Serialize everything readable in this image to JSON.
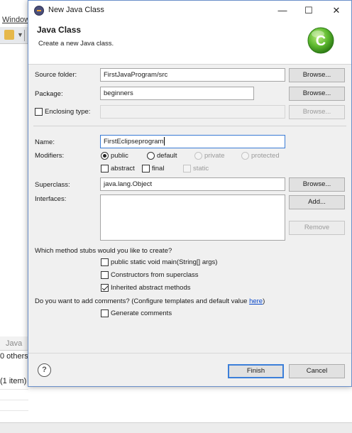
{
  "background": {
    "menu_label": "Window",
    "panel_tab_label": "Java",
    "problems_text": "0 others",
    "items_text": "(1 item)"
  },
  "titlebar": {
    "title": "New Java Class",
    "minimize_glyph": "—",
    "maximize_glyph": "☐",
    "close_glyph": "✕"
  },
  "header": {
    "title": "Java Class",
    "subtitle": "Create a new Java class."
  },
  "form": {
    "source_folder_label": "Source folder:",
    "source_folder_value": "FirstJavaProgram/src",
    "package_label": "Package:",
    "package_value": "beginners",
    "enclosing_type_label": "Enclosing type:",
    "enclosing_type_value": "",
    "browse_label": "Browse...",
    "name_label": "Name:",
    "name_value": "FirstEclipseprogram",
    "modifiers_label": "Modifiers:",
    "modifier_public": "public",
    "modifier_default": "default",
    "modifier_private": "private",
    "modifier_protected": "protected",
    "modifier_abstract": "abstract",
    "modifier_final": "final",
    "modifier_static": "static",
    "superclass_label": "Superclass:",
    "superclass_value": "java.lang.Object",
    "interfaces_label": "Interfaces:",
    "add_label": "Add...",
    "remove_label": "Remove",
    "stubs_question": "Which method stubs would you like to create?",
    "stub_main": "public static void main(String[] args)",
    "stub_constructors": "Constructors from superclass",
    "stub_inherited": "Inherited abstract methods",
    "comments_question_prefix": "Do you want to add comments? (Configure templates and default value ",
    "comments_link": "here",
    "comments_question_suffix": ")",
    "generate_comments": "Generate comments"
  },
  "state": {
    "selected_modifier": "public",
    "abstract_checked": false,
    "final_checked": false,
    "static_checked": false,
    "stub_main_checked": false,
    "stub_constructors_checked": false,
    "stub_inherited_checked": true,
    "generate_comments_checked": false
  },
  "footer": {
    "help_glyph": "?",
    "finish_label": "Finish",
    "cancel_label": "Cancel"
  },
  "colors": {
    "dialog_bg": "#f0f0f0",
    "focus_border": "#3a7bd5",
    "link": "#0645c8",
    "logo_green": "#5cb82e"
  },
  "icons": {
    "window_icon": "eclipse-icon",
    "wizard_logo": "new-class-c-icon",
    "help": "help-icon"
  }
}
